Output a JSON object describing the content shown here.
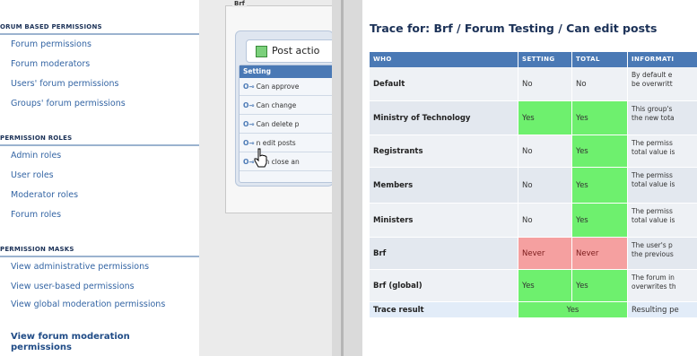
{
  "sidebar": {
    "sections": [
      {
        "title": "ORUM BASED PERMISSIONS",
        "items": [
          "Forum permissions",
          "Forum moderators",
          "Users' forum permissions",
          "Groups' forum permissions"
        ]
      },
      {
        "title": "PERMISSION ROLES",
        "items": [
          "Admin roles",
          "User roles",
          "Moderator roles",
          "Forum roles"
        ]
      },
      {
        "title": "PERMISSION MASKS",
        "items": [
          "View administrative permissions",
          "View user-based permissions",
          "View global moderation permissions",
          "View forum moderation permissions"
        ]
      }
    ]
  },
  "middle": {
    "legend": "Brf",
    "post_action_label": "Post actio",
    "setting_header": "Setting",
    "settings": [
      "Can approve",
      "Can change",
      "Can delete p",
      "n edit posts",
      "Can close an"
    ]
  },
  "trace": {
    "title": "Trace for: Brf / Forum Testing / Can edit posts",
    "columns": [
      "WHO",
      "SETTING",
      "TOTAL",
      "INFORMATI"
    ],
    "rows": [
      {
        "who": "Default",
        "setting": "No",
        "total": "No",
        "info": "By default e\nbe overwritt",
        "setting_state": "neutral",
        "total_state": "neutral"
      },
      {
        "who": "Ministry of Technology",
        "setting": "Yes",
        "total": "Yes",
        "info": "This group's\nthe new tota",
        "setting_state": "yes",
        "total_state": "yes"
      },
      {
        "who": "Registrants",
        "setting": "No",
        "total": "Yes",
        "info": "The permiss\ntotal value is",
        "setting_state": "neutral",
        "total_state": "yes"
      },
      {
        "who": "Members",
        "setting": "No",
        "total": "Yes",
        "info": "The permiss\ntotal value is",
        "setting_state": "neutral",
        "total_state": "yes"
      },
      {
        "who": "Ministers",
        "setting": "No",
        "total": "Yes",
        "info": "The permiss\ntotal value is",
        "setting_state": "neutral",
        "total_state": "yes"
      },
      {
        "who": "Brf",
        "setting": "Never",
        "total": "Never",
        "info": "The user's p\nthe previous",
        "setting_state": "never",
        "total_state": "never"
      },
      {
        "who": "Brf (global)",
        "setting": "Yes",
        "total": "Yes",
        "info": "The forum in\noverwrites th",
        "setting_state": "yes",
        "total_state": "yes"
      }
    ],
    "result": {
      "label": "Trace result",
      "value": "Yes",
      "info": "Resulting pe"
    }
  },
  "colors": {
    "header_blue": "#4a79b5",
    "yes_green": "#6ef06e",
    "never_red": "#f5a0a0",
    "link_blue": "#3465a4"
  }
}
